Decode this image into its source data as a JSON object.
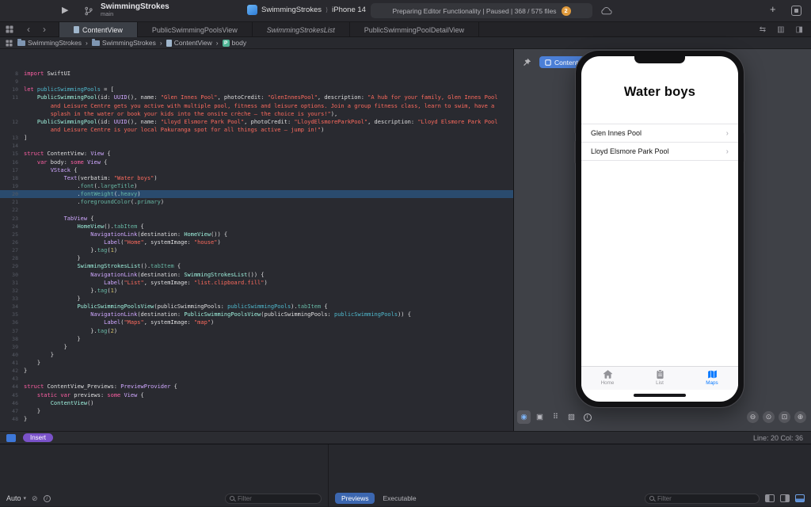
{
  "toolbar": {
    "play_icon": "▶",
    "project_title": "SwimmingStrokes",
    "branch_name": "main",
    "scheme_name": "SwimmingStrokes",
    "scheme_separator": "⟩",
    "run_destination": "iPhone 14",
    "activity_status": "Preparing Editor Functionality | Paused | 368 / 575 files",
    "warning_count": "2",
    "plus_icon": "+"
  },
  "tabbar": {
    "back_icon": "‹",
    "forward_icon": "›",
    "swap_icon": "⇆",
    "options_icon": "▥",
    "split_icon": "◨",
    "tabs": [
      {
        "label": "ContentView",
        "active": true
      },
      {
        "label": "PublicSwimmingPoolsView"
      },
      {
        "label": "SwimmingStrokesList",
        "italic": true
      },
      {
        "label": "PublicSwimmingPoolDetailView"
      }
    ]
  },
  "jumpbar": {
    "separator": "›",
    "crumbs": [
      {
        "icon": "folder",
        "label": "SwimmingStrokes"
      },
      {
        "icon": "folder",
        "label": "SwimmingStrokes"
      },
      {
        "icon": "swift-file",
        "label": "ContentView"
      },
      {
        "icon": "property",
        "badge": "P",
        "label": "body"
      }
    ]
  },
  "editor": {
    "current_line": 20,
    "rows": [
      {
        "n": 8,
        "s": [
          [
            "k",
            "import"
          ],
          [
            "p",
            " SwiftUI"
          ]
        ]
      },
      {
        "n": 9,
        "s": []
      },
      {
        "n": 10,
        "s": [
          [
            "k",
            "let"
          ],
          [
            "p",
            " "
          ],
          [
            "g",
            "publicSwimmingPools"
          ],
          [
            "p",
            " = ["
          ]
        ]
      },
      {
        "n": 11,
        "s": [
          [
            "p",
            "    "
          ],
          [
            "pt",
            "PublicSwimmingPool"
          ],
          [
            "p",
            "(id: "
          ],
          [
            "t",
            "UUID"
          ],
          [
            "p",
            "(), name: "
          ],
          [
            "s",
            "\"Glen Innes Pool\""
          ],
          [
            "p",
            ", photoCredit: "
          ],
          [
            "s",
            "\"GlenInnesPool\""
          ],
          [
            "p",
            ", description: "
          ],
          [
            "s",
            "\"A hub for your family, Glen Innes Pool"
          ]
        ]
      },
      {
        "s": [
          [
            "s",
            "        and Leisure Centre gets you active with multiple pool, fitness and leisure options. Join a group fitness class, learn to swim, have a"
          ]
        ]
      },
      {
        "s": [
          [
            "s",
            "        splash in the water or book your kids into the onsite crèche – the choice is yours!\""
          ],
          [
            "p",
            "),"
          ]
        ]
      },
      {
        "n": 12,
        "s": [
          [
            "p",
            "    "
          ],
          [
            "pt",
            "PublicSwimmingPool"
          ],
          [
            "p",
            "(id: "
          ],
          [
            "t",
            "UUID"
          ],
          [
            "p",
            "(), name: "
          ],
          [
            "s",
            "\"Lloyd Elsmore Park Pool\""
          ],
          [
            "p",
            ", photoCredit: "
          ],
          [
            "s",
            "\"LloydElsmoreParkPool\""
          ],
          [
            "p",
            ", description: "
          ],
          [
            "s",
            "\"Lloyd Elsmore Park Pool"
          ]
        ]
      },
      {
        "s": [
          [
            "s",
            "        and Leisure Centre is your local Pakuranga spot for all things active – jump in!\""
          ],
          [
            "p",
            ")"
          ]
        ]
      },
      {
        "n": 13,
        "s": [
          [
            "p",
            "]"
          ]
        ]
      },
      {
        "n": 14,
        "s": []
      },
      {
        "n": 15,
        "s": [
          [
            "k",
            "struct"
          ],
          [
            "p",
            " ContentView: "
          ],
          [
            "t",
            "View"
          ],
          [
            "p",
            " {"
          ]
        ]
      },
      {
        "n": 16,
        "s": [
          [
            "p",
            "    "
          ],
          [
            "k",
            "var"
          ],
          [
            "p",
            " body: "
          ],
          [
            "k",
            "some"
          ],
          [
            "p",
            " "
          ],
          [
            "t",
            "View"
          ],
          [
            "p",
            " {"
          ]
        ]
      },
      {
        "n": 17,
        "s": [
          [
            "p",
            "        "
          ],
          [
            "t",
            "VStack"
          ],
          [
            "p",
            " {"
          ]
        ]
      },
      {
        "n": 18,
        "s": [
          [
            "p",
            "            "
          ],
          [
            "t",
            "Text"
          ],
          [
            "p",
            "(verbatim: "
          ],
          [
            "s",
            "\"Water boys\""
          ],
          [
            "p",
            ")"
          ]
        ]
      },
      {
        "n": 19,
        "s": [
          [
            "p",
            "                ."
          ],
          [
            "m",
            "font"
          ],
          [
            "p",
            "(."
          ],
          [
            "m",
            "largeTitle"
          ],
          [
            "p",
            ")"
          ]
        ]
      },
      {
        "n": 20,
        "s": [
          [
            "p",
            "                ."
          ],
          [
            "m",
            "fontWeight"
          ],
          [
            "p",
            "(."
          ],
          [
            "m",
            "heavy"
          ],
          [
            "p",
            ")"
          ]
        ]
      },
      {
        "n": 21,
        "s": [
          [
            "p",
            "                ."
          ],
          [
            "m",
            "foregroundColor"
          ],
          [
            "p",
            "(."
          ],
          [
            "m",
            "primary"
          ],
          [
            "p",
            ")"
          ]
        ]
      },
      {
        "n": 22,
        "s": []
      },
      {
        "n": 23,
        "s": [
          [
            "p",
            "            "
          ],
          [
            "t",
            "TabView"
          ],
          [
            "p",
            " {"
          ]
        ]
      },
      {
        "n": 24,
        "s": [
          [
            "p",
            "                "
          ],
          [
            "pt",
            "HomeView"
          ],
          [
            "p",
            "()."
          ],
          [
            "m",
            "tabItem"
          ],
          [
            "p",
            " {"
          ]
        ]
      },
      {
        "n": 25,
        "s": [
          [
            "p",
            "                    "
          ],
          [
            "t",
            "NavigationLink"
          ],
          [
            "p",
            "(destination: "
          ],
          [
            "pt",
            "HomeView"
          ],
          [
            "p",
            "()) {"
          ]
        ]
      },
      {
        "n": 26,
        "s": [
          [
            "p",
            "                        "
          ],
          [
            "t",
            "Label"
          ],
          [
            "p",
            "("
          ],
          [
            "s",
            "\"Home\""
          ],
          [
            "p",
            ", systemImage: "
          ],
          [
            "s",
            "\"house\""
          ],
          [
            "p",
            ")"
          ]
        ]
      },
      {
        "n": 27,
        "s": [
          [
            "p",
            "                    }."
          ],
          [
            "m",
            "tag"
          ],
          [
            "p",
            "("
          ],
          [
            "num",
            "1"
          ],
          [
            "p",
            ")"
          ]
        ]
      },
      {
        "n": 28,
        "s": [
          [
            "p",
            "                }"
          ]
        ]
      },
      {
        "n": 29,
        "s": [
          [
            "p",
            "                "
          ],
          [
            "pt",
            "SwimmingStrokesList"
          ],
          [
            "p",
            "()."
          ],
          [
            "m",
            "tabItem"
          ],
          [
            "p",
            " {"
          ]
        ]
      },
      {
        "n": 30,
        "s": [
          [
            "p",
            "                    "
          ],
          [
            "t",
            "NavigationLink"
          ],
          [
            "p",
            "(destination: "
          ],
          [
            "pt",
            "SwimmingStrokesList"
          ],
          [
            "p",
            "()) {"
          ]
        ]
      },
      {
        "n": 31,
        "s": [
          [
            "p",
            "                        "
          ],
          [
            "t",
            "Label"
          ],
          [
            "p",
            "("
          ],
          [
            "s",
            "\"List\""
          ],
          [
            "p",
            ", systemImage: "
          ],
          [
            "s",
            "\"list.clipboard.fill\""
          ],
          [
            "p",
            ")"
          ]
        ]
      },
      {
        "n": 32,
        "s": [
          [
            "p",
            "                    }."
          ],
          [
            "m",
            "tag"
          ],
          [
            "p",
            "("
          ],
          [
            "num",
            "1"
          ],
          [
            "p",
            ")"
          ]
        ]
      },
      {
        "n": 33,
        "s": [
          [
            "p",
            "                }"
          ]
        ]
      },
      {
        "n": 34,
        "s": [
          [
            "p",
            "                "
          ],
          [
            "pt",
            "PublicSwimmingPoolsView"
          ],
          [
            "p",
            "(publicSwimmingPools: "
          ],
          [
            "g",
            "publicSwimmingPools"
          ],
          [
            "p",
            ")."
          ],
          [
            "m",
            "tabItem"
          ],
          [
            "p",
            " {"
          ]
        ]
      },
      {
        "n": 35,
        "s": [
          [
            "p",
            "                    "
          ],
          [
            "t",
            "NavigationLink"
          ],
          [
            "p",
            "(destination: "
          ],
          [
            "pt",
            "PublicSwimmingPoolsView"
          ],
          [
            "p",
            "(publicSwimmingPools: "
          ],
          [
            "g",
            "publicSwimmingPools"
          ],
          [
            "p",
            ")) {"
          ]
        ]
      },
      {
        "n": 36,
        "s": [
          [
            "p",
            "                        "
          ],
          [
            "t",
            "Label"
          ],
          [
            "p",
            "("
          ],
          [
            "s",
            "\"Maps\""
          ],
          [
            "p",
            ", systemImage: "
          ],
          [
            "s",
            "\"map\""
          ],
          [
            "p",
            ")"
          ]
        ]
      },
      {
        "n": 37,
        "s": [
          [
            "p",
            "                    }."
          ],
          [
            "m",
            "tag"
          ],
          [
            "p",
            "("
          ],
          [
            "num",
            "2"
          ],
          [
            "p",
            ")"
          ]
        ]
      },
      {
        "n": 38,
        "s": [
          [
            "p",
            "                }"
          ]
        ]
      },
      {
        "n": 39,
        "s": [
          [
            "p",
            "            }"
          ]
        ]
      },
      {
        "n": 40,
        "s": [
          [
            "p",
            "        }"
          ]
        ]
      },
      {
        "n": 41,
        "s": [
          [
            "p",
            "    }"
          ]
        ]
      },
      {
        "n": 42,
        "s": [
          [
            "p",
            "}"
          ]
        ]
      },
      {
        "n": 43,
        "s": []
      },
      {
        "n": 44,
        "s": [
          [
            "k",
            "struct"
          ],
          [
            "p",
            " ContentView_Previews: "
          ],
          [
            "t",
            "PreviewProvider"
          ],
          [
            "p",
            " {"
          ]
        ]
      },
      {
        "n": 45,
        "s": [
          [
            "p",
            "    "
          ],
          [
            "k",
            "static"
          ],
          [
            "p",
            " "
          ],
          [
            "k",
            "var"
          ],
          [
            "p",
            " previews: "
          ],
          [
            "k",
            "some"
          ],
          [
            "p",
            " "
          ],
          [
            "t",
            "View"
          ],
          [
            "p",
            " {"
          ]
        ]
      },
      {
        "n": 46,
        "s": [
          [
            "p",
            "        "
          ],
          [
            "pt",
            "ContentView"
          ],
          [
            "p",
            "()"
          ]
        ]
      },
      {
        "n": 47,
        "s": [
          [
            "p",
            "    }"
          ]
        ]
      },
      {
        "n": 48,
        "s": [
          [
            "p",
            "}"
          ]
        ]
      }
    ]
  },
  "statusbar": {
    "mode_label": "Insert",
    "caret_position": "Line: 20  Col: 36"
  },
  "canvas": {
    "badge_label": "Content View",
    "control_buttons": [
      {
        "name": "live-preview",
        "glyph": "◉",
        "active": true
      },
      {
        "name": "selectable-mode",
        "glyph": "▣"
      },
      {
        "name": "variants-mode",
        "glyph": "⠿"
      },
      {
        "name": "color-scheme-variants",
        "glyph": "▨"
      },
      {
        "name": "accessibility-preview",
        "glyph": "i"
      }
    ],
    "zoom_buttons": [
      {
        "name": "zoom-out",
        "glyph": "⊖"
      },
      {
        "name": "zoom-actual-size",
        "glyph": "⊙"
      },
      {
        "name": "zoom-to-fit",
        "glyph": "⊡"
      },
      {
        "name": "zoom-in",
        "glyph": "⊕"
      }
    ]
  },
  "phone": {
    "app_title": "Water boys",
    "active_color": "#0a7aff",
    "inactive_color": "#939398",
    "list_rows": [
      {
        "label": "Glen Innes Pool",
        "chevron": "›"
      },
      {
        "label": "Lloyd Elsmore Park Pool",
        "chevron": "›"
      }
    ],
    "tab_items": [
      {
        "icon": "house",
        "label": "Home"
      },
      {
        "icon": "clipboard",
        "label": "List"
      },
      {
        "icon": "map",
        "label": "Maps",
        "active": true
      }
    ]
  },
  "debug": {
    "scope_label": "Auto",
    "chevron": "▾",
    "slash_icon": "⊘",
    "filter_placeholder": "Filter",
    "process_tabs": [
      {
        "label": "Previews",
        "active": true
      },
      {
        "label": "Executable"
      }
    ]
  }
}
